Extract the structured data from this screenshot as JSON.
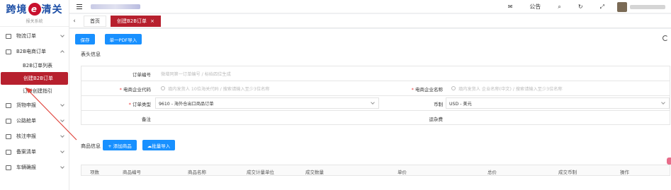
{
  "logo": {
    "name_left": "跨境",
    "name_e": "e",
    "name_right": "清关",
    "subtitle": "报关系统"
  },
  "sidebar": {
    "items": [
      {
        "label": "物流订单"
      },
      {
        "label": "B2B电商订单"
      },
      {
        "label": "B2B订单列表"
      },
      {
        "label": "创建B2B订单"
      },
      {
        "label": "订单创建指引"
      },
      {
        "label": "货物申报"
      },
      {
        "label": "公路舱单"
      },
      {
        "label": "核注申报"
      },
      {
        "label": "备案清单"
      },
      {
        "label": "车辆确报"
      }
    ]
  },
  "topbar": {
    "mail_label": "✉",
    "notice_label": "公告",
    "search_label": "⌕",
    "refresh_label": "↻",
    "expand_label": "⤢"
  },
  "tabs": {
    "back": "‹",
    "home": "首页",
    "active": "创建B2B订单",
    "close": "×"
  },
  "toolbar": {
    "save": "保存",
    "pdf_import": "单一PDF导入"
  },
  "header_section": {
    "title": "表头信息"
  },
  "form": {
    "order_no_label": "订单编号",
    "order_no_placeholder": "微增同第一订单编号 / 标始四位生成",
    "ec_code_label": "电商企业代码",
    "ec_code_placeholder": "填内发货人 10位海关代码 / 搜索请输入至少3位名称",
    "ec_name_label": "电商企业名称",
    "ec_name_placeholder": "填内发货人 企业名称(中文) / 搜索请输入至少3位名称",
    "order_type_label": "订单类型",
    "order_type_value": "9610 - 海外仓出口商品订单",
    "currency_label": "币制",
    "currency_value": "USD - 美元",
    "remark_label": "备注",
    "freight_label": "运杂费"
  },
  "goods": {
    "title": "商品信息",
    "add_button": "+ 添加商品",
    "batch_import": "☁批量导入",
    "columns": [
      "项数",
      "商品编号",
      "商品名称",
      "成交计量单位",
      "成交数量",
      "单价",
      "总价",
      "成交币制",
      "操作"
    ]
  },
  "colors": {
    "brand_red": "#b7202e",
    "primary_blue": "#1890ff",
    "logo_blue": "#1d4fa6"
  }
}
